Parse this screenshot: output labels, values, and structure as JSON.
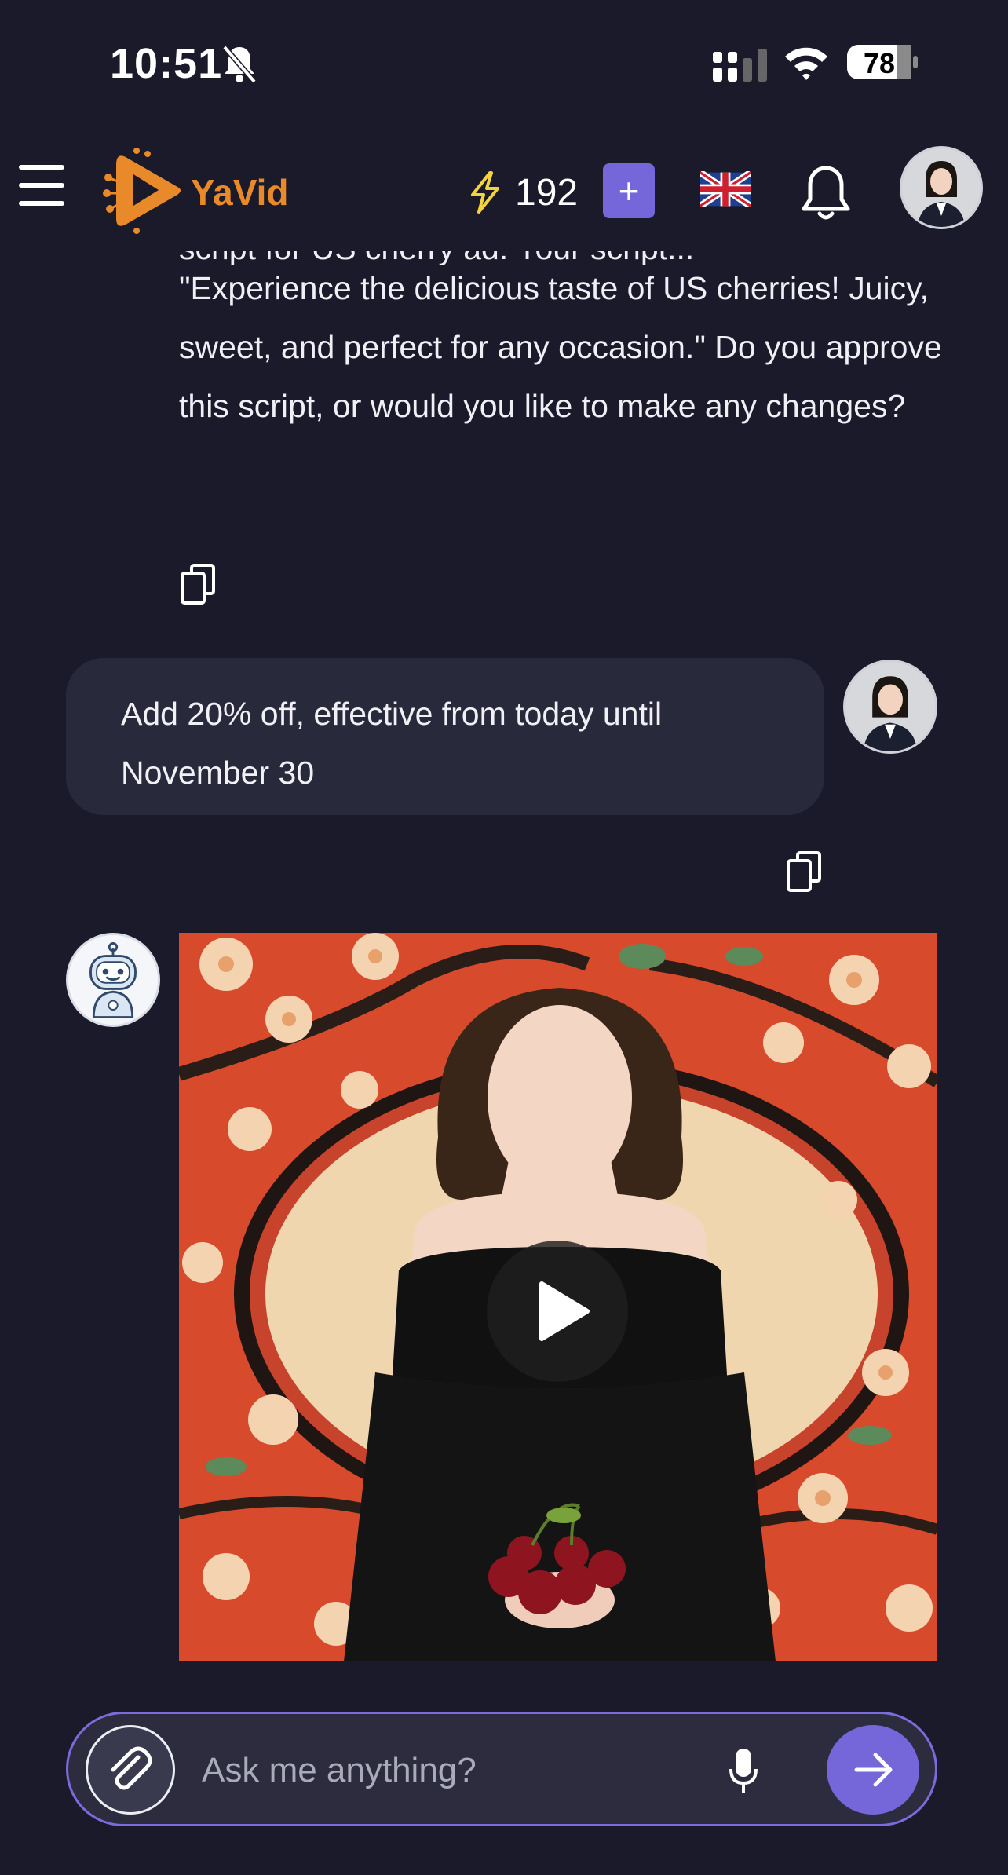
{
  "status_bar": {
    "time": "10:51",
    "battery": "78"
  },
  "header": {
    "app_name": "YaVid",
    "credits": "192",
    "add_label": "+",
    "accent_color": "#7566d9",
    "logo_color": "#e8892a"
  },
  "chat": {
    "bot_message_cut": "script for US cherry ad: Your script...",
    "bot_message": "\"Experience the delicious taste of US cherries! Juicy, sweet, and perfect for any occasion.\" Do you approve this script, or would you like to make any changes?",
    "user_message": "Add 20% off, effective from today until November 30"
  },
  "composer": {
    "placeholder": "Ask me anything?"
  },
  "icons": [
    "menu-icon",
    "logo-icon",
    "bolt-icon",
    "uk-flag-icon",
    "bell-icon",
    "copy-icon",
    "robot-icon",
    "play-icon",
    "paperclip-icon",
    "mic-icon",
    "arrow-right-icon"
  ]
}
